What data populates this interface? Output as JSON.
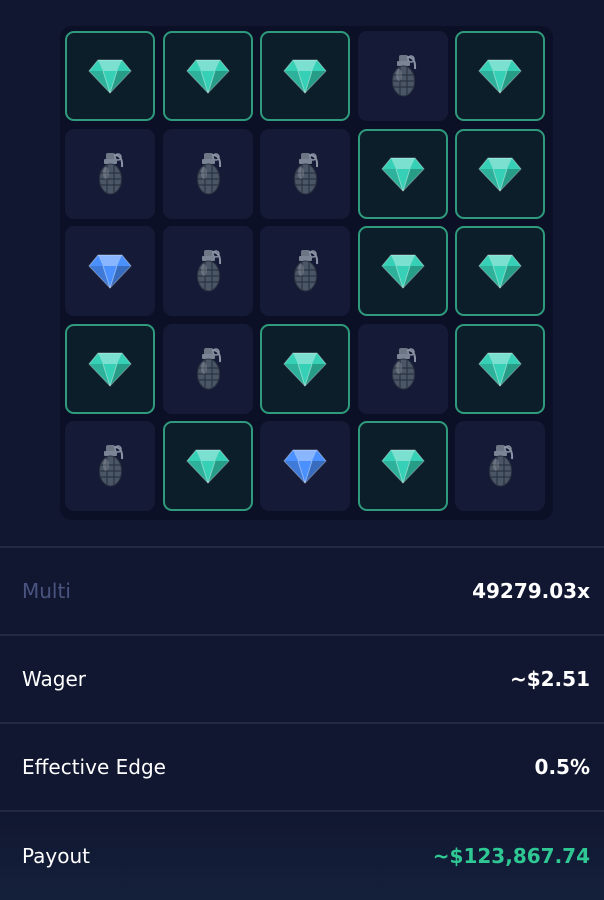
{
  "board": {
    "rows": 5,
    "cols": 5,
    "tiles": [
      [
        "gem-revealed",
        "gem-revealed",
        "gem-revealed",
        "mine",
        "gem-revealed"
      ],
      [
        "mine",
        "mine",
        "mine",
        "gem-revealed",
        "gem-revealed"
      ],
      [
        "gem-hidden",
        "mine",
        "mine",
        "gem-revealed",
        "gem-revealed"
      ],
      [
        "gem-revealed",
        "mine",
        "gem-revealed",
        "mine",
        "gem-revealed"
      ],
      [
        "mine",
        "gem-revealed",
        "gem-hidden",
        "gem-revealed",
        "mine"
      ]
    ],
    "icons": {
      "gem-revealed": "green-gem-icon",
      "gem-hidden": "blue-gem-icon",
      "mine": "grenade-icon"
    },
    "colors": {
      "revealed_border": "#2f9a7c",
      "gem_green": "#35d0b5",
      "gem_blue": "#4a90ff",
      "payout": "#2fc793"
    }
  },
  "stats": {
    "multi_label": "Multi",
    "multi_value": "49279.03x",
    "wager_label": "Wager",
    "wager_value": "~$2.51",
    "edge_label": "Effective Edge",
    "edge_value": "0.5%",
    "payout_label": "Payout",
    "payout_value": "~$123,867.74"
  }
}
